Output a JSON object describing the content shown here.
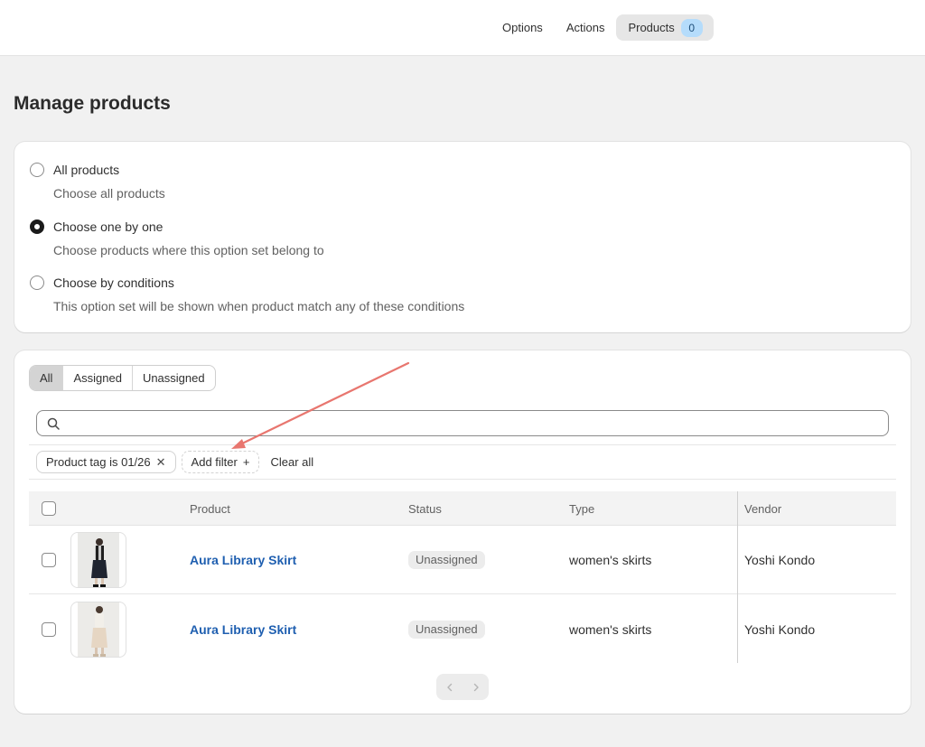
{
  "topbar": {
    "nav": [
      {
        "label": "Options"
      },
      {
        "label": "Actions"
      },
      {
        "label": "Products",
        "count": "0"
      }
    ]
  },
  "page": {
    "title": "Manage products"
  },
  "selection": {
    "options": [
      {
        "label": "All products",
        "help": "Choose all products",
        "checked": false
      },
      {
        "label": "Choose one by one",
        "help": "Choose products where this option set belong to",
        "checked": true
      },
      {
        "label": "Choose by conditions",
        "help": "This option set will be shown when product match any of these conditions",
        "checked": false
      }
    ]
  },
  "list": {
    "tabs": [
      {
        "label": "All",
        "active": true
      },
      {
        "label": "Assigned",
        "active": false
      },
      {
        "label": "Unassigned",
        "active": false
      }
    ],
    "search": {
      "placeholder": "",
      "value": ""
    },
    "filters": {
      "applied": "Product tag is 01/26",
      "add_label": "Add filter",
      "clear_label": "Clear all"
    },
    "columns": [
      "Product",
      "Status",
      "Type",
      "Vendor"
    ],
    "rows": [
      {
        "name": "Aura Library Skirt",
        "status": "Unassigned",
        "type": "women's skirts",
        "vendor": "Yoshi Kondo"
      },
      {
        "name": "Aura Library Skirt",
        "status": "Unassigned",
        "type": "women's skirts",
        "vendor": "Yoshi Kondo"
      }
    ]
  },
  "colors": {
    "accent_link": "#1f5fb0",
    "badge_bg": "#b5dcfb",
    "annotation_arrow": "#e8766f"
  }
}
